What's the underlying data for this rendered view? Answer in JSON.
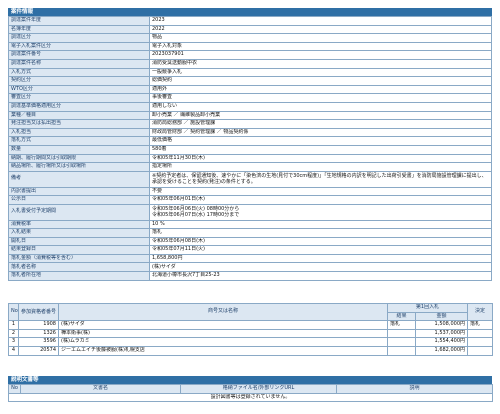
{
  "case": {
    "title": "案件情報",
    "rows": [
      {
        "k": "調達案件年度",
        "v": "2023"
      },
      {
        "k": "名簿年度",
        "v": "2022"
      },
      {
        "k": "調達区分",
        "v": "物品"
      },
      {
        "k": "電子入札案件区分",
        "v": "電子入札対象"
      },
      {
        "k": "調達案件番号",
        "v": "2023037901"
      },
      {
        "k": "調達案件名称",
        "v": "消防受臭送動服中衣"
      },
      {
        "k": "入札方式",
        "v": "一般競争入札"
      },
      {
        "k": "契約区分",
        "v": "総価契約"
      },
      {
        "k": "WTO区分",
        "v": "適用外"
      },
      {
        "k": "審査区分",
        "v": "事後審査"
      },
      {
        "k": "調達基準価格適用区分",
        "v": "適用しない"
      },
      {
        "k": "業種／種目",
        "v": "卸小売業 ／ 繊維製品卸小売業"
      },
      {
        "k": "発注担当又は払出担当",
        "v": "消防局総務部 ／ 施設管理課"
      },
      {
        "k": "入札担当",
        "v": "財政局管財部 ／ 契約管理課 ／ 物品契約係"
      },
      {
        "k": "落札方式",
        "v": "最低価格"
      },
      {
        "k": "数量",
        "v": "580着"
      },
      {
        "k": "納期、履行期間又は引取期限",
        "v": "令和05年11月30日(木)"
      },
      {
        "k": "納品場所、履行場所又は引取場所",
        "v": "指定場所"
      },
      {
        "k": "備考",
        "v": "※契約予定者は、保留通知後、速やかに「染色済の生地(見付で30cm程度)」「生地規格の内訳を明記した出荷引受書」を消防局施設管理課に提出し、承認を受けることを契約(発注)の条件とする。",
        "wrap": true
      },
      {
        "k": "内訳書提出",
        "v": "不要"
      },
      {
        "k": "公示日",
        "v": "令和05年06月01日(木)"
      },
      {
        "k": "入札書受付予定期間",
        "v": "令和05年06月06日(火) 08時00分から\n令和05年06月07日(水) 17時00分まで",
        "wrap": true
      },
      {
        "k": "消費税率",
        "v": "10 %"
      },
      {
        "k": "入札結果",
        "v": "落札"
      },
      {
        "k": "開札日",
        "v": "令和05年06月08日(木)"
      },
      {
        "k": "結果登録日",
        "v": "令和05年07月11日(火)"
      },
      {
        "k": "落札金額（消費税等を含む）",
        "v": "1,658,800円"
      },
      {
        "k": "落札者名称",
        "v": "(株)サイダ"
      },
      {
        "k": "落札者所在地",
        "v": "北海道小樽市長沢7丁目25-23"
      }
    ]
  },
  "bids": {
    "headers": {
      "no": "No",
      "num": "参加資格者番号",
      "name": "商号又は名称",
      "round": "第1回入札",
      "result": "結果",
      "amount": "金額",
      "decision": "決定"
    },
    "rows": [
      {
        "no": "1",
        "num": "1908",
        "name": "(株)サイダ",
        "result": "落札",
        "amount": "1,508,000円",
        "decision": "落札"
      },
      {
        "no": "2",
        "num": "1326",
        "name": "樺本衛事(株)",
        "result": "",
        "amount": "1,537,000円",
        "decision": ""
      },
      {
        "no": "3",
        "num": "3596",
        "name": "(株)ムラカミ",
        "result": "",
        "amount": "1,554,400円",
        "decision": ""
      },
      {
        "no": "4",
        "num": "20574",
        "name": "ジーエムエイチ後藤被服(株)札幌支店",
        "result": "",
        "amount": "1,682,000円",
        "decision": ""
      }
    ]
  },
  "docs": {
    "title": "説明文書等",
    "headers": {
      "no": "No",
      "name": "文書名",
      "file": "格納ファイル名/外部リンクURL",
      "desc": "説明"
    },
    "empty": "設計図書等は登録されていません。"
  }
}
